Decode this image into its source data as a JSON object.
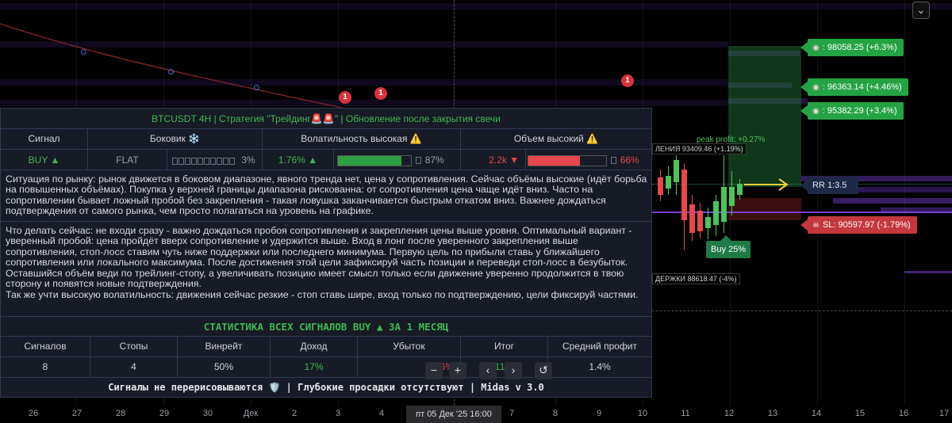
{
  "panel": {
    "title": "BTCUSDT 4H | Стратегия \"Трейдинг🚨🚨\" | Обновление после закрытия свечи",
    "headers": {
      "signal": "Сигнал",
      "sideways": "Боковик ❄️",
      "volatility": "Волатильность высокая ⚠️",
      "volume": "Объем высокий ⚠️"
    },
    "values": {
      "signal": "BUY ▲",
      "trend": "FLAT",
      "sideways_pct": "3%",
      "sideways_level": 0.03,
      "volatility_val": "1.76% ▲",
      "volatility_pct": "87%",
      "volatility_level": 0.87,
      "volume_val": "2.2k ▼",
      "volume_pct": "66%",
      "volume_level": 0.66
    },
    "situation": "Ситуация по рынку: рынок движется в боковом диапазоне, явного тренда нет, цена у сопротивления. Сейчас объёмы высокие (идёт борьба на повышенных объёмах). Покупка у верхней границы диапазона рискованна: от сопротивления цена чаще идёт вниз. Часто на сопротивлении бывает ложный пробой без закрепления - такая ловушка заканчивается быстрым откатом вниз. Важнее дождаться подтверждения от самого рынка, чем просто полагаться на уровень на графике.",
    "advice": "Что делать сейчас: не входи сразу - важно дождаться пробоя сопротивления и закрепления цены выше уровня. Оптимальный вариант - уверенный пробой: цена пройдёт вверх сопротивление и удержится выше. Вход в лонг после уверенного закрепления выше сопротивления, стоп-лосс ставим чуть ниже поддержки или последнего минимума. Первую цель по прибыли ставь у ближайшего сопротивления или локального максимума. После достижения этой цели зафиксируй часть позиции и переведи стоп-лосс в безубыток. Оставшийся объём веди по трейлинг-стопу, а увеличивать позицию имеет смысл только если движение уверенно продолжится в твою сторону и появятся новые подтверждения.",
    "advice2": "Так же учти высокую волатильность: движения сейчас резкие - стоп ставь шире, вход только по подтверждению, цели фиксируй частями.",
    "stats_title": "СТАТИСТИКА ВСЕХ СИГНАЛОВ BUY ▲ ЗА 1 МЕСЯЦ",
    "stats_headers": [
      "Сигналов",
      "Стопы",
      "Винрейт",
      "Доход",
      "Убыток",
      "Итог",
      "Средний профит"
    ],
    "stats_values": [
      "8",
      "4",
      "50%",
      "17%",
      "6%",
      "11%",
      "1.4%"
    ],
    "footer": "Сигналы не перерисовываются 🛡️ | Глубокие просадки отсутствуют | Midas v 3.0"
  },
  "chart": {
    "tags": {
      "tp3": ": 98058.25 (+6.3%)",
      "tp2": ": 96363.14 (+4.46%)",
      "tp1": ": 95382.29 (+3.4%)",
      "rr": "RR 1:3.5",
      "sl": "SL: 90597.97 (-1.79%)"
    },
    "resistance_label": "ЛЕНИЯ 93409.46 (+1.19%)",
    "support_label": "ДЕРЖКИ 88618.47 (-4%)",
    "peak_profit": "peak profit: +0.27%",
    "buy_flag": "Buy 25%",
    "markers": [
      "1",
      "1",
      "1"
    ],
    "controls": [
      "−",
      "+",
      "‹",
      "›",
      "↺"
    ],
    "menu_icon": "⌄"
  },
  "xaxis": {
    "ticks": [
      "26",
      "27",
      "28",
      "29",
      "30",
      "Дек",
      "2",
      "3",
      "4",
      "7",
      "8",
      "9",
      "10",
      "11",
      "12",
      "13",
      "14",
      "15",
      "16",
      "17"
    ],
    "crosshair_label": "пт 05 Дек '25   16:00"
  },
  "colors": {
    "green": "#3fb950",
    "red": "#e5484d",
    "yellow": "#e3b341",
    "panel_bg": "#181c28",
    "tag_green": "#25a244",
    "tag_red": "#c4373e"
  }
}
